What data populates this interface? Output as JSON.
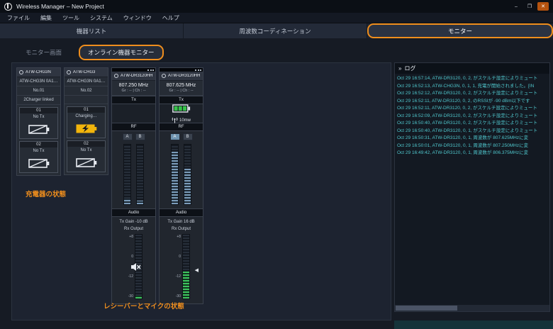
{
  "colors": {
    "accent_orange": "#ef8e1d",
    "log_text": "#4fc6cc",
    "battery_charging": "#f2b50c",
    "battery_ok": "#37c24a",
    "meter_rf": "#7b9cba",
    "meter_audio": "#3ec45e"
  },
  "titlebar": {
    "title": "Wireless Manager – New Project",
    "minimize": "–",
    "maximize": "❐",
    "close": "✕"
  },
  "menubar": {
    "items": [
      "ファイル",
      "編集",
      "ツール",
      "システム",
      "ウィンドウ",
      "ヘルプ"
    ]
  },
  "tabs": {
    "items": [
      {
        "label": "機器リスト",
        "active": false
      },
      {
        "label": "周波数コーディネーション",
        "active": false
      },
      {
        "label": "モニター",
        "active": true
      }
    ]
  },
  "subtabs": {
    "items": [
      {
        "label": "モニター画面",
        "active": false
      },
      {
        "label": "オンライン機器モニター",
        "active": true
      }
    ]
  },
  "chargers": [
    {
      "name": "ATW-CHG3N",
      "id": "ATW-CHG3N 0A1…",
      "no": "No.01",
      "linked": "2Charger linked",
      "slots": [
        {
          "label": "01",
          "status": "No Tx",
          "battery": "empty"
        },
        {
          "label": "02",
          "status": "No Tx",
          "battery": "empty"
        }
      ]
    },
    {
      "name": "ATW-CHG3",
      "id": "ATW-CHG3N 0A1…",
      "no": "No.02",
      "linked": "",
      "slots": [
        {
          "label": "01",
          "status": "Charging…",
          "battery": "charging"
        },
        {
          "label": "02",
          "status": "No Tx",
          "battery": "empty"
        }
      ]
    }
  ],
  "receivers": [
    {
      "name": "ATW-DR3120HH1",
      "frequency": "807.250 MHz",
      "grch": "Gr : -- | Ch : --",
      "tx_label": "Tx",
      "rf_label": "RF",
      "audio_label": "Audio",
      "ant_a": "A",
      "ant_b": "B",
      "tx_gain": "Tx Gain -10 dB",
      "rx_output": "Rx Output",
      "scale": [
        "+8",
        "0",
        "-12",
        "-30"
      ],
      "rf_a_level": 10,
      "rf_b_level": 6,
      "audio_level": 5,
      "muted": true
    },
    {
      "name": "ATW-DR3120HH1",
      "frequency": "807.625 MHz",
      "grch": "Gr : -- | Ch : --",
      "tx_label": "Tx",
      "rf_label": "RF",
      "audio_label": "Audio",
      "tx_power": "10mw",
      "ant_a": "A",
      "ant_b": "B",
      "tx_gain": "Tx Gain 16 dB",
      "rx_output": "Rx Output",
      "scale": [
        "+8",
        "0",
        "-12",
        "-30"
      ],
      "rf_a_level": 88,
      "rf_b_level": 60,
      "audio_level": 42,
      "muted": false
    }
  ],
  "annotations": {
    "chargers": "充電器の状態",
    "receivers": "レシーバーとマイクの状態"
  },
  "log": {
    "title": "ログ",
    "entries": [
      "Oct 29 16:57:14, ATW-DR3120, 0, 2, がスケルチ設定によりミュート",
      "Oct 29 16:52:13, ATW-CHG3N, 0, 1, 1, 充電が開始されました。[IN",
      "Oct 29 16:52:12, ATW-DR3120, 0, 2, がスケルチ設定によりミュート",
      "Oct 29 16:52:11, ATW-DR3120, 0, 2, のRSSIが -90 dBm以下です",
      "Oct 29 16:52:11, ATW-DR3120, 0, 2, がスケルチ設定によりミュート",
      "Oct 29 16:52:09, ATW-DR3120, 0, 2, がスケルチ設定によりミュート",
      "Oct 29 16:50:40, ATW-DR3120, 0, 2, がスケルチ設定によりミュート",
      "Oct 29 16:50:40, ATW-DR3120, 0, 1, がスケルチ設定によりミュート",
      "Oct 29 16:50:31, ATW-DR3120, 0, 1, 周波数が 807.625MHzに変",
      "Oct 29 16:50:01, ATW-DR3120, 0, 1, 周波数が 807.250MHzに変",
      "Oct 29 16:49:42, ATW-DR3120, 0, 1, 周波数が 806.375MHzに変"
    ]
  }
}
